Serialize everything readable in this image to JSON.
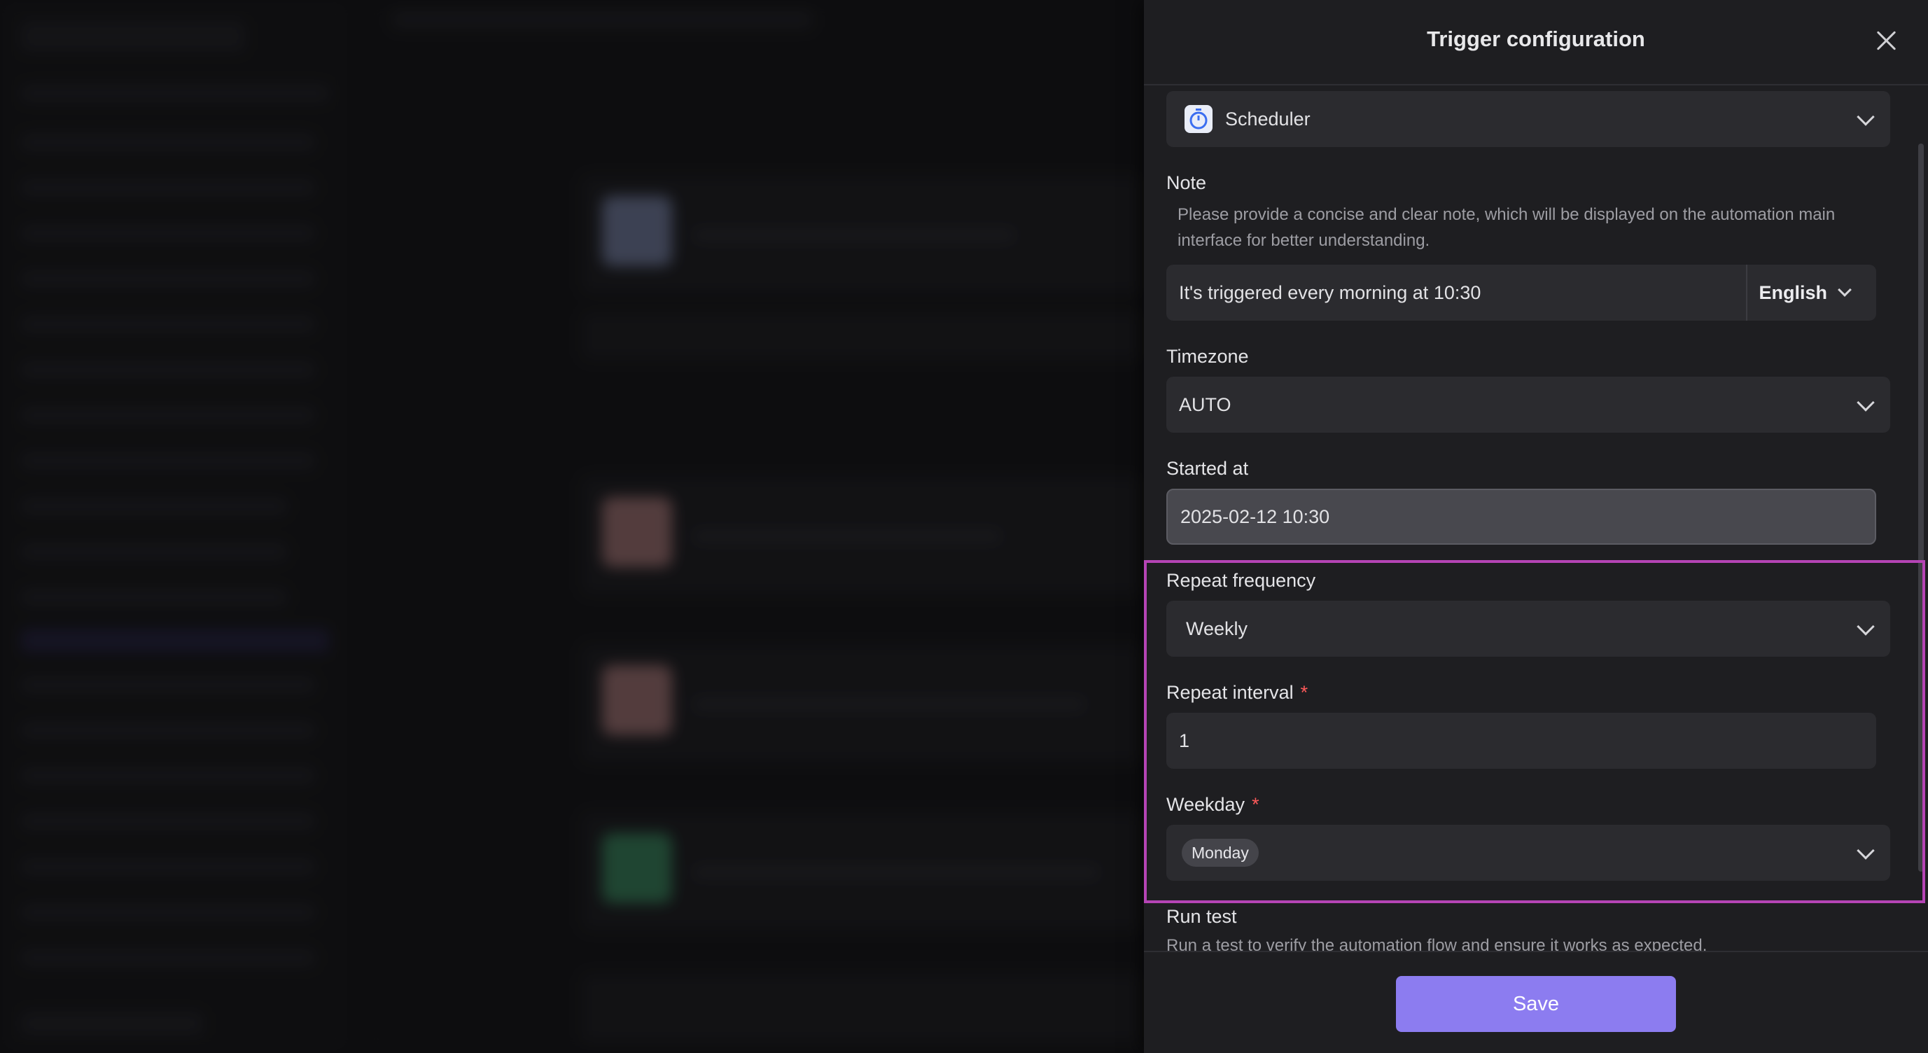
{
  "drawer": {
    "title": "Trigger configuration"
  },
  "trigger": {
    "type_value": "Scheduler"
  },
  "note": {
    "label": "Note",
    "hint": "Please provide a concise and clear note, which will be displayed on the automation main interface for better understanding.",
    "value": "It's triggered every morning at 10:30",
    "language": "English"
  },
  "timezone": {
    "label": "Timezone",
    "value": "AUTO"
  },
  "started_at": {
    "label": "Started at",
    "value": "2025-02-12 10:30"
  },
  "repeat_frequency": {
    "label": "Repeat frequency",
    "value": "Weekly"
  },
  "repeat_interval": {
    "label": "Repeat interval",
    "required_mark": "*",
    "value": "1"
  },
  "weekday": {
    "label": "Weekday",
    "required_mark": "*",
    "selected": "Monday"
  },
  "run_test": {
    "label": "Run test",
    "hint": "Run a test to verify the automation flow and ensure it works as expected."
  },
  "footer": {
    "save_label": "Save"
  },
  "colors": {
    "accent": "#8c7cf0",
    "highlight": "#b544b5",
    "required": "#ff5a5a"
  },
  "icons": {
    "trigger": "stopwatch-icon",
    "close": "close-icon",
    "dropdown": "chevron-down-icon"
  }
}
